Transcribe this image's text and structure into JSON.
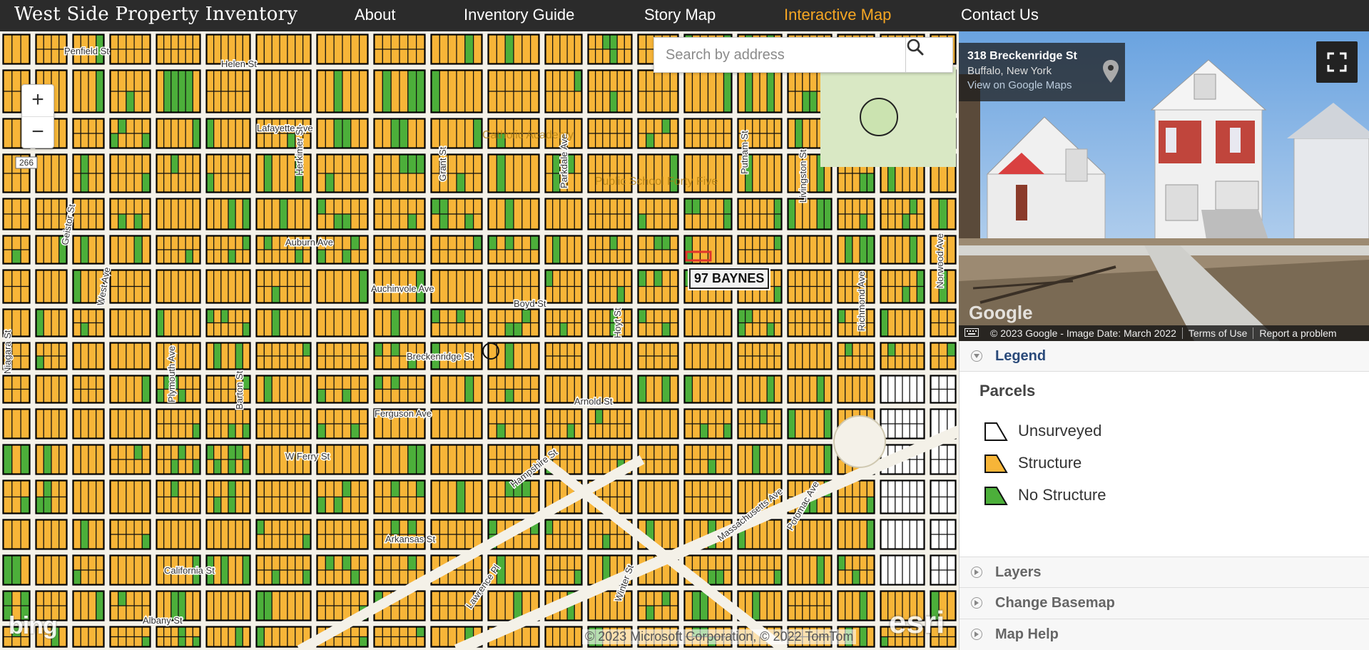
{
  "header": {
    "site_title": "West Side Property Inventory",
    "nav": [
      {
        "label": "About",
        "active": false
      },
      {
        "label": "Inventory Guide",
        "active": false
      },
      {
        "label": "Story Map",
        "active": false
      },
      {
        "label": "Interactive Map",
        "active": true
      },
      {
        "label": "Contact Us",
        "active": false
      }
    ],
    "active_color": "#f5a623"
  },
  "map": {
    "search": {
      "placeholder": "Search by address",
      "value": ""
    },
    "zoom_in": "+",
    "zoom_out": "−",
    "selected_parcel_label": "97 BAYNES",
    "basemap_logo": "bing",
    "attribution": "© 2023 Microsoft Corporation, © 2022 TomTom",
    "esri_logo": "esri",
    "streets": [
      "Penfield St",
      "Helen St",
      "Lafayette Ave",
      "Herkimer St",
      "Grant St",
      "Parkdale Ave",
      "Auburn Ave",
      "Geistor St",
      "West Ave",
      "Auchinvole Ave",
      "Boyd St",
      "Hoyt St",
      "Putnam St",
      "Livingston St",
      "Breckenridge St",
      "Ferguson Ave",
      "Arnold St",
      "W Ferry St",
      "Niagara St",
      "Plymouth Ave",
      "Barton St",
      "Richmond Ave",
      "Norwood Ave",
      "Hampshire St",
      "Arkansas St",
      "California St",
      "Albany St",
      "Lawrence Pl",
      "Winter St",
      "Massachusetts Ave",
      "Potomac Ave"
    ],
    "areas": [
      "Catholic Academy",
      "Public School Forty Five"
    ],
    "route_shield": "266",
    "colors": {
      "structure": "#f7b538",
      "no_structure": "#4caf3a",
      "unsurveyed": "#ffffff",
      "road": "#f4f1e8",
      "selection": "#e0342c"
    }
  },
  "streetview": {
    "address_line1": "318 Breckenridge St",
    "address_line2": "Buffalo, New York",
    "link": "View on Google Maps",
    "watermark": "Google",
    "attribution": "© 2023 Google - Image Date: March 2022",
    "terms": "Terms of Use",
    "report": "Report a problem"
  },
  "panel": {
    "legend": {
      "title": "Legend",
      "section": "Parcels",
      "items": [
        {
          "label": "Unsurveyed",
          "color": "#ffffff"
        },
        {
          "label": "Structure",
          "color": "#f7b538"
        },
        {
          "label": "No Structure",
          "color": "#4caf3a"
        }
      ]
    },
    "sections": [
      "Layers",
      "Change Basemap",
      "Map Help"
    ]
  }
}
